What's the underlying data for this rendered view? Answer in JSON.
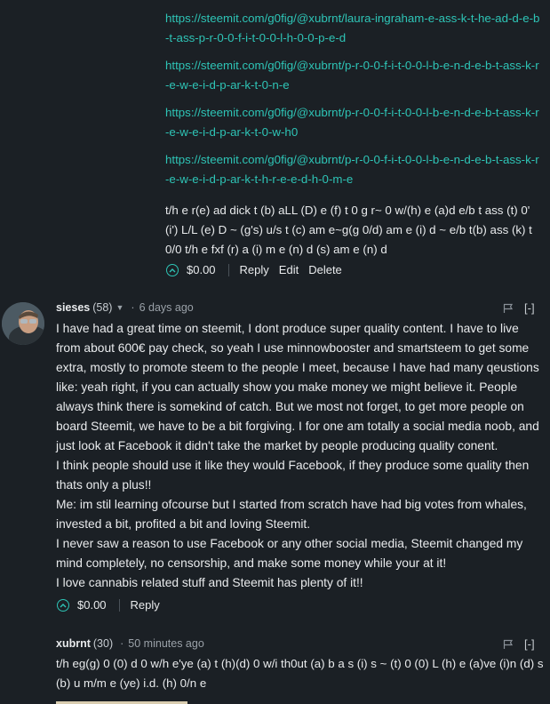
{
  "links": [
    "https://steemit.com/g0fig/@xubrnt/laura-ingraham-e-ass-k-t-he-ad-d-e-b-t-ass-p-r-0-0-f-i-t-0-0-l-h-0-0-p-e-d",
    "https://steemit.com/g0fig/@xubrnt/p-r-0-0-f-i-t-0-0-l-b-e-n-d-e-b-t-ass-k-r-e-w-e-i-d-p-ar-k-t-0-n-e",
    "https://steemit.com/g0fig/@xubrnt/p-r-0-0-f-i-t-0-0-l-b-e-n-d-e-b-t-ass-k-r-e-w-e-i-d-p-ar-k-t-0-w-h0",
    "https://steemit.com/g0fig/@xubrnt/p-r-0-0-f-i-t-0-0-l-b-e-n-d-e-b-t-ass-k-r-e-w-e-i-d-p-ar-k-t-h-r-e-e-d-h-0-m-e"
  ],
  "top_reply": {
    "text": "t/h e r(e) ad dick t (b) aLL (D) e (f) t 0 g r~ 0 w/(h) e (a)d e/b t ass (t) 0' (i') L/L (e) D ~ (g's) u/s t (c) am e~g(g 0/d) am e (i) d ~ e/b t(b) ass (k) t 0/0 t/h e fxf (r) a (i) m e (n) d (s) am e (n) d",
    "payout": "$0.00",
    "reply_label": "Reply",
    "edit_label": "Edit",
    "delete_label": "Delete"
  },
  "comment1": {
    "author": "sieses",
    "reputation": "(58)",
    "time": "6 days ago",
    "collapse": "[-]",
    "paragraphs": [
      "I have had a great time on steemit, I dont produce super quality content. I have to live from about 600€ pay check, so yeah I use minnowbooster and smartsteem to get some extra, mostly to promote steem to the people I meet, because I have had many qeustions like: yeah right, if you can actually show you make money we might believe it. People always think there is somekind of catch. But we most not forget, to get more people on board Steemit, we have to be a bit forgiving. I for one am totally a social media noob, and just look at Facebook it didn't take the market by people producing quality conent.",
      "I think people should use it like they would Facebook, if they produce some quality then thats only a plus!!",
      "Me: im stil learning ofcourse but I started from scratch have had big votes from whales, invested a bit, profited a bit and loving Steemit.",
      "I never saw a reason to use Facebook or any other social media, Steemit changed my mind completely, no censorship, and make some money while your at it!",
      "I love cannabis related stuff and Steemit has plenty of it!!"
    ],
    "payout": "$0.00",
    "reply_label": "Reply"
  },
  "comment2": {
    "author": "xubrnt",
    "reputation": "(30)",
    "time": "50 minutes ago",
    "collapse": "[-]",
    "text": "t/h eg(g) 0 (0) d 0 w/h e'ye (a) t (h)(d) 0 w/i th0ut (a) b a s (i) s ~ (t) 0 (0) L (h) e (a)ve (i)n (d) s (b) u m/m e (ye) i.d. (h) 0/n e"
  },
  "colors": {
    "background": "#1b2025",
    "link": "#2ec4b6",
    "text": "#e8eaec",
    "muted": "#9aa1a8"
  }
}
